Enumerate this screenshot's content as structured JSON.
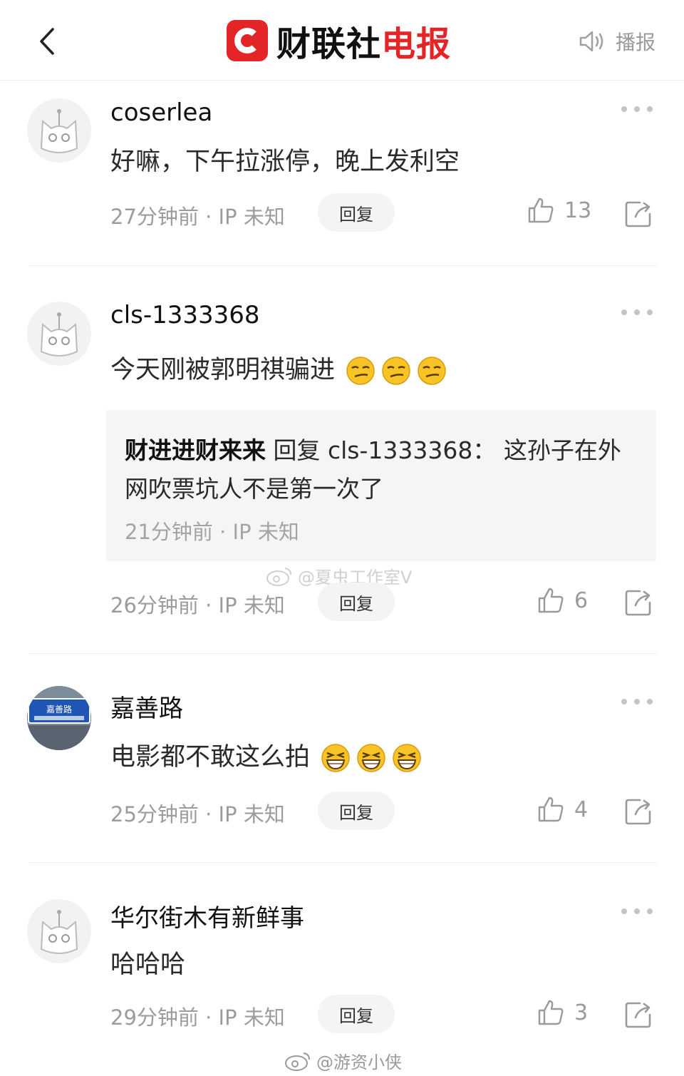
{
  "header": {
    "brand_left": "财联社",
    "brand_right": "电报",
    "broadcast_label": "播报"
  },
  "colors": {
    "brand_red": "#e32528",
    "muted_gray": "#9c9c9c",
    "reply_bg": "#f5f5f5"
  },
  "comments": [
    {
      "username": "coserlea",
      "content": "好嘛，下午拉涨停，晚上发利空",
      "emoji": [],
      "meta": "27分钟前 · IP 未知",
      "reply_label": "回复",
      "likes": "13",
      "avatar_icon": "cat-avatar-icon"
    },
    {
      "username": "cls-1333368",
      "content": "今天刚被郭明祺骗进",
      "emoji": [
        "smirk-emoji",
        "smirk-emoji",
        "smirk-emoji"
      ],
      "reply": {
        "author": "财进进财来来",
        "reply_word": " 回复 ",
        "target": "cls-1333368：",
        "text": " 这孙子在外网吹票坑人不是第一次了",
        "meta": "21分钟前 · IP 未知"
      },
      "meta": "26分钟前 · IP 未知",
      "reply_label": "回复",
      "likes": "6",
      "avatar_icon": "cat-avatar-icon"
    },
    {
      "username": "嘉善路",
      "content": "电影都不敢这么拍",
      "emoji": [
        "grin-emoji",
        "grin-emoji",
        "grin-emoji"
      ],
      "meta": "25分钟前 · IP 未知",
      "reply_label": "回复",
      "likes": "4",
      "avatar_icon": "street-sign-avatar",
      "avatar_sign_text": "嘉善路"
    },
    {
      "username": "华尔街木有新鲜事",
      "content": "哈哈哈",
      "emoji": [],
      "meta": "29分钟前 · IP 未知",
      "reply_label": "回复",
      "likes": "3",
      "avatar_icon": "cat-avatar-icon"
    }
  ],
  "watermarks": {
    "middle": "@夏虫工作室V",
    "bottom": "@游资小侠"
  }
}
